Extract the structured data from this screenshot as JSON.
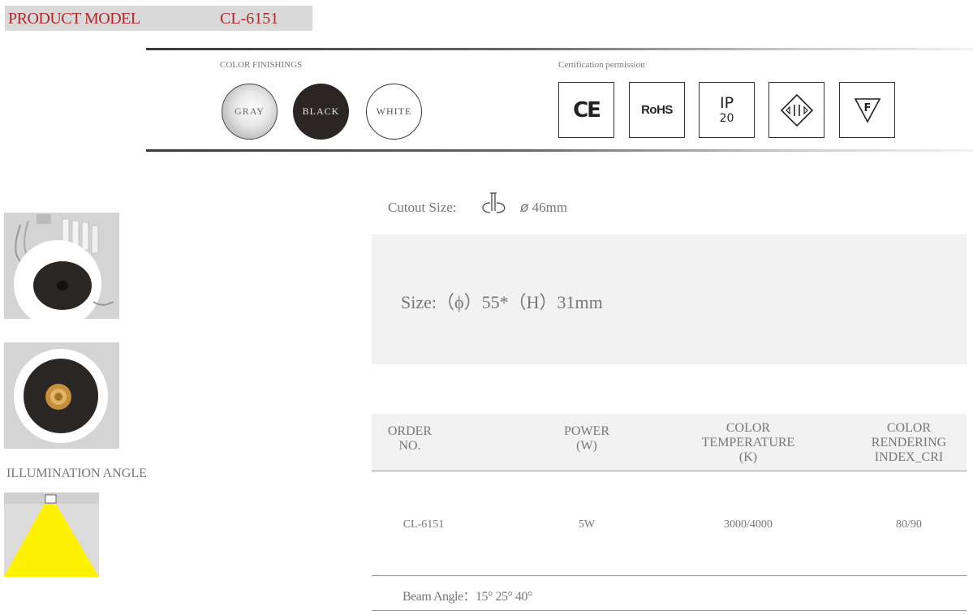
{
  "header": {
    "model_label": "PRODUCT MODEL",
    "model_value": "CL-6151",
    "brand_color": "#b3262a"
  },
  "color_finishings": {
    "label": "COLOR FINISHINGS",
    "options": [
      "GRAY",
      "BLACK",
      "WHITE"
    ]
  },
  "certification": {
    "label": "Certification permission",
    "items": [
      {
        "icon": "ce-mark-icon",
        "text": "CE"
      },
      {
        "icon": "rohs-icon",
        "text": "RoHS"
      },
      {
        "icon": "ip-rating-icon",
        "line1": "IP",
        "line2": "20"
      },
      {
        "icon": "class-ii-icon"
      },
      {
        "icon": "f-mark-icon",
        "text": "F"
      }
    ]
  },
  "illumination": {
    "label": "ILLUMINATION ANGLE"
  },
  "specs": {
    "cutout_label": "Cutout Size:",
    "cutout_value": "46mm",
    "size_text": "Size:（ϕ）55*（H）31mm"
  },
  "table": {
    "headers": [
      [
        "ORDER",
        "NO."
      ],
      [
        "POWER",
        "(W)"
      ],
      [
        "COLOR",
        "TEMPERATURE",
        "(K)"
      ],
      [
        "COLOR",
        "RENDERING",
        "INDEX_CRI"
      ]
    ],
    "row": [
      "CL-6151",
      "5W",
      "3000/4000",
      "80/90"
    ],
    "beam_angle": "Beam Angle：15°  25°  40°"
  }
}
